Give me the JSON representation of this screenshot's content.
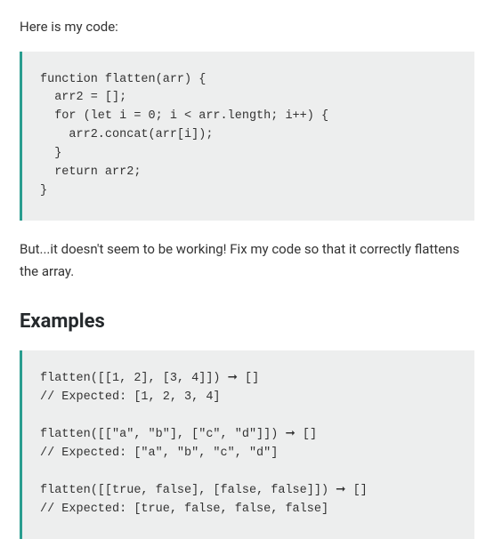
{
  "intro": "Here is my code:",
  "code": "function flatten(arr) {\n  arr2 = [];\n  for (let i = 0; i < arr.length; i++) {\n    arr2.concat(arr[i]);\n  }\n  return arr2;\n}",
  "body": "But...it doesn't seem to be working! Fix my code so that it correctly flattens the array.",
  "examples_heading": "Examples",
  "examples": "flatten([[1, 2], [3, 4]]) ➞ []\n// Expected: [1, 2, 3, 4]\n\nflatten([[\"a\", \"b\"], [\"c\", \"d\"]]) ➞ []\n// Expected: [\"a\", \"b\", \"c\", \"d\"]\n\nflatten([[true, false], [false, false]]) ➞ []\n// Expected: [true, false, false, false]"
}
